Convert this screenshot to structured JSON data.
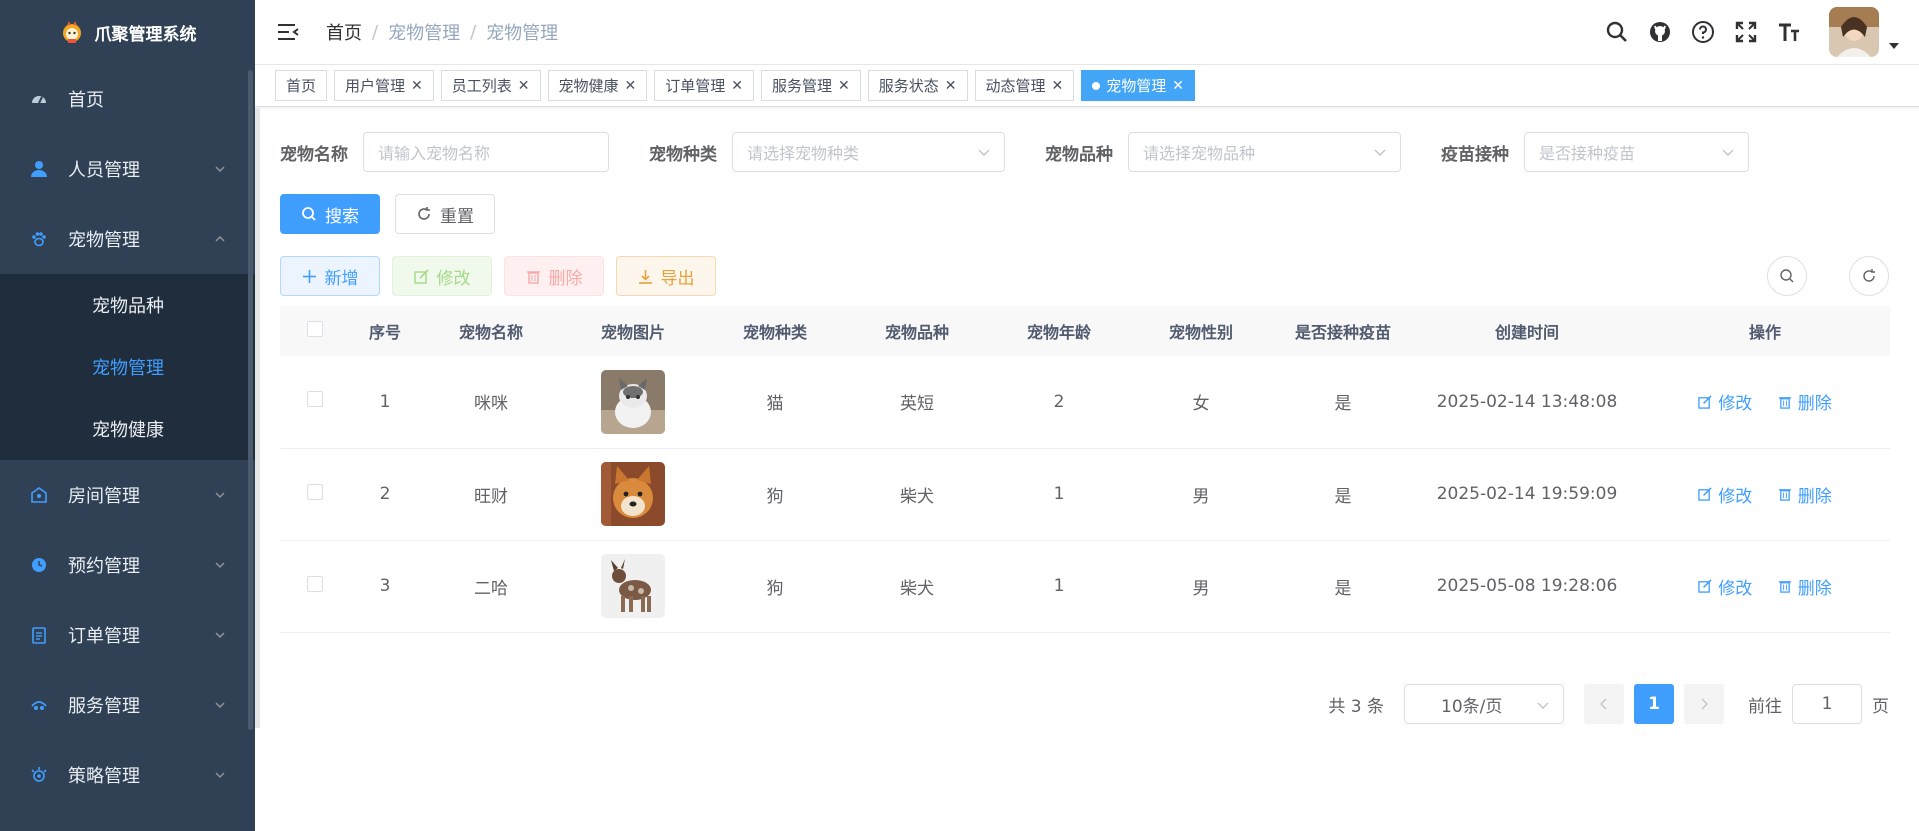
{
  "app": {
    "title": "爪聚管理系统"
  },
  "sidebar": {
    "items": [
      {
        "label": "首页",
        "icon": "dashboard-icon"
      },
      {
        "label": "人员管理",
        "icon": "user-icon"
      },
      {
        "label": "宠物管理",
        "icon": "paw-icon",
        "open": true,
        "children": [
          {
            "label": "宠物品种"
          },
          {
            "label": "宠物管理",
            "active": true
          },
          {
            "label": "宠物健康"
          }
        ]
      },
      {
        "label": "房间管理",
        "icon": "room-icon"
      },
      {
        "label": "预约管理",
        "icon": "clock-icon"
      },
      {
        "label": "订单管理",
        "icon": "clipboard-icon"
      },
      {
        "label": "服务管理",
        "icon": "service-icon"
      },
      {
        "label": "策略管理",
        "icon": "strategy-icon"
      }
    ]
  },
  "breadcrumb": [
    "首页",
    "宠物管理",
    "宠物管理"
  ],
  "tags": [
    {
      "label": "首页",
      "closable": false
    },
    {
      "label": "用户管理",
      "closable": true
    },
    {
      "label": "员工列表",
      "closable": true
    },
    {
      "label": "宠物健康",
      "closable": true
    },
    {
      "label": "订单管理",
      "closable": true
    },
    {
      "label": "服务管理",
      "closable": true
    },
    {
      "label": "服务状态",
      "closable": true
    },
    {
      "label": "动态管理",
      "closable": true
    },
    {
      "label": "宠物管理",
      "closable": true,
      "active": true
    }
  ],
  "search": {
    "name_label": "宠物名称",
    "name_placeholder": "请输入宠物名称",
    "type_label": "宠物种类",
    "type_placeholder": "请选择宠物种类",
    "breed_label": "宠物品种",
    "breed_placeholder": "请选择宠物品种",
    "vaccine_label": "疫苗接种",
    "vaccine_placeholder": "是否接种疫苗",
    "search_btn": "搜索",
    "reset_btn": "重置"
  },
  "toolbar": {
    "add": "新增",
    "edit": "修改",
    "delete": "删除",
    "export": "导出"
  },
  "table": {
    "headers": [
      "序号",
      "宠物名称",
      "宠物图片",
      "宠物种类",
      "宠物品种",
      "宠物年龄",
      "宠物性别",
      "是否接种疫苗",
      "创建时间",
      "操作"
    ],
    "rows": [
      {
        "no": "1",
        "name": "咪咪",
        "img": "cat",
        "type": "猫",
        "breed": "英短",
        "age": "2",
        "gender": "女",
        "vaccine": "是",
        "time": "2025-02-14 13:48:08"
      },
      {
        "no": "2",
        "name": "旺财",
        "img": "shiba",
        "type": "狗",
        "breed": "柴犬",
        "age": "1",
        "gender": "男",
        "vaccine": "是",
        "time": "2025-02-14 19:59:09"
      },
      {
        "no": "3",
        "name": "二哈",
        "img": "dog",
        "type": "狗",
        "breed": "柴犬",
        "age": "1",
        "gender": "男",
        "vaccine": "是",
        "time": "2025-05-08 19:28:06"
      }
    ],
    "op_edit": "修改",
    "op_delete": "删除"
  },
  "pagination": {
    "total": "共 3 条",
    "page_size": "10条/页",
    "current": "1",
    "goto_label": "前往",
    "goto_value": "1",
    "page_suffix": "页"
  },
  "colors": {
    "primary": "#409eff",
    "sidebar_bg": "#304156",
    "submenu_bg": "#1f2d3d"
  }
}
